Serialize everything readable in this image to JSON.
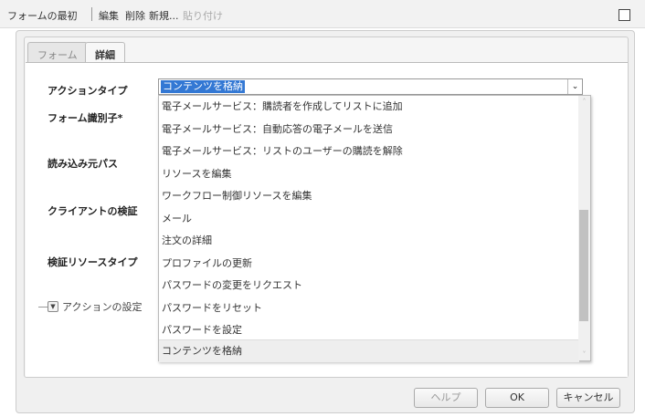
{
  "toolbar": {
    "form_top": "フォームの最初",
    "edit": "編集",
    "delete": "削除",
    "new": "新規...",
    "paste": "貼り付け"
  },
  "tabs": [
    {
      "label": "フォーム"
    },
    {
      "label": "詳細"
    }
  ],
  "labels": {
    "action_type": "アクションタイプ",
    "form_id": "フォーム識別子*",
    "load_path": "読み込み元パス",
    "client_validation": "クライアントの検証",
    "validation_resource_type": "検証リソースタイプ",
    "action_settings": "アクションの設定"
  },
  "select": {
    "value": "コンテンツを格納"
  },
  "options": [
    "電子メールサービス：購読者を作成してリストに追加",
    "電子メールサービス：自動応答の電子メールを送信",
    "電子メールサービス：リストのユーザーの購読を解除",
    "リソースを編集",
    "ワークフロー制御リソースを編集",
    "メール",
    "注文の詳細",
    "プロファイルの更新",
    "パスワードの変更をリクエスト",
    "パスワードをリセット",
    "パスワードを設定",
    "コンテンツを格納"
  ],
  "buttons": {
    "help": "ヘルプ",
    "ok": "OK",
    "cancel": "キャンセル"
  }
}
